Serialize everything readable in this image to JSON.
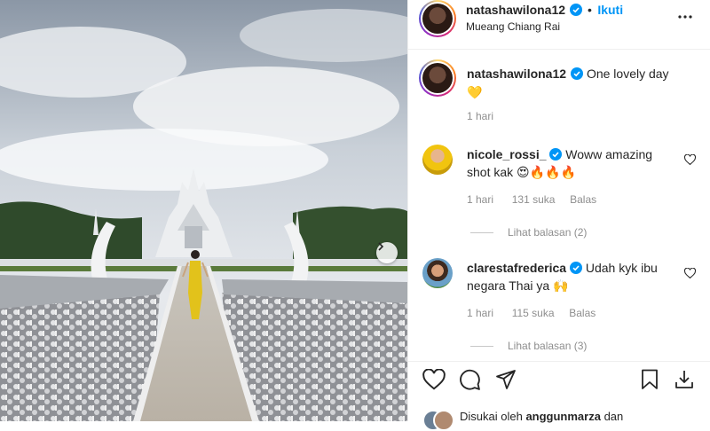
{
  "post": {
    "username": "natashawilona12",
    "follow_label": "Ikuti",
    "separator": "•",
    "location": "Mueang Chiang Rai",
    "caption": "One lovely day",
    "caption_emoji": "💛",
    "caption_time": "1 hari"
  },
  "comments": [
    {
      "username": "nicole_rossi_",
      "text": "Woww amazing",
      "text_line2": "shot kak 😍🔥🔥🔥",
      "time": "1 hari",
      "likes": "131 suka",
      "reply_label": "Balas",
      "view_replies": "Lihat balasan (2)"
    },
    {
      "username": "clarestafrederica",
      "text": "Udah kyk ibu",
      "text_line2": "negara Thai ya 🙌",
      "time": "1 hari",
      "likes": "115 suka",
      "reply_label": "Balas",
      "view_replies": "Lihat balasan (3)"
    }
  ],
  "liked_by": {
    "prefix": "Disukai oleh ",
    "user": "anggunmarza",
    "suffix": " dan"
  },
  "icons": [
    "verified-badge-icon",
    "more-options-icon",
    "heart-icon",
    "comment-icon",
    "share-icon",
    "bookmark-icon",
    "download-icon",
    "chevron-right-icon"
  ],
  "colors": {
    "follow": "#0095f6",
    "verified": "#0095f6",
    "meta": "#8e8e8e"
  }
}
